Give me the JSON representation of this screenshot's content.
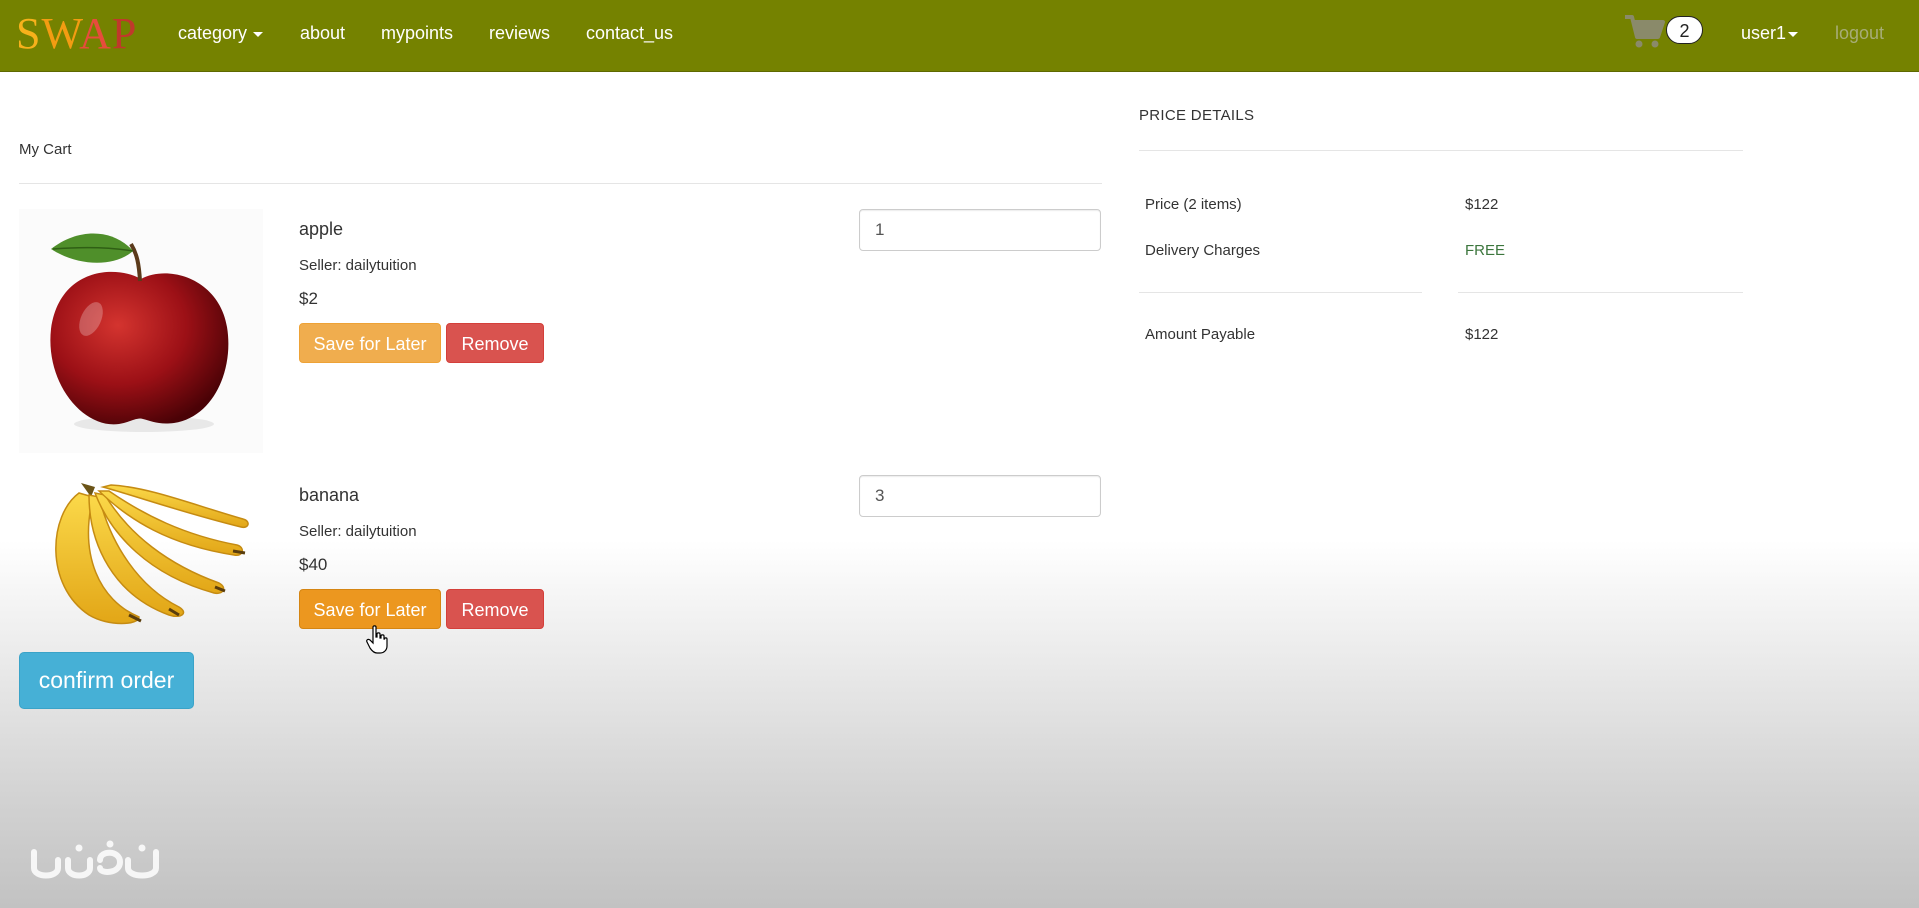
{
  "navbar": {
    "brand_letters": [
      "S",
      "W",
      "A",
      "P"
    ],
    "links": {
      "category": "category",
      "about": "about",
      "mypoints": "mypoints",
      "reviews": "reviews",
      "contact_us": "contact_us"
    },
    "cart_icon": "shopping-cart-icon",
    "cart_count": "2",
    "user": "user1",
    "logout": "logout",
    "bar_color": "#758200"
  },
  "cart": {
    "heading": "My Cart",
    "items": [
      {
        "name": "apple",
        "seller": "Seller: dailytuition",
        "price": "$2",
        "quantity": "1",
        "save_label": "Save for Later",
        "remove_label": "Remove",
        "image": "apple-image"
      },
      {
        "name": "banana",
        "seller": "Seller: dailytuition",
        "price": "$40",
        "quantity": "3",
        "save_label": "Save for Later",
        "remove_label": "Remove",
        "image": "banana-image"
      }
    ],
    "confirm_label": "confirm order"
  },
  "price_details": {
    "title": "PRICE DETAILS",
    "price_label": "Price (2 items)",
    "price_value": "$122",
    "delivery_label": "Delivery Charges",
    "delivery_value": "FREE",
    "payable_label": "Amount Payable",
    "payable_value": "$122"
  },
  "watermark": "نفث"
}
